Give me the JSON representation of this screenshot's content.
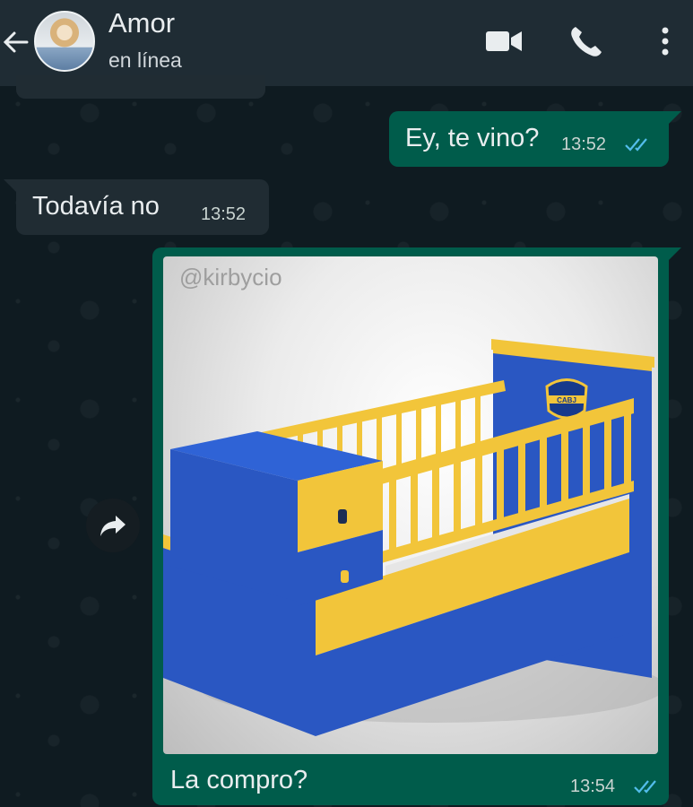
{
  "header": {
    "contact_name": "Amor",
    "status": "en línea",
    "back_icon": "back-arrow-icon",
    "icons": [
      "video-call-icon",
      "voice-call-icon",
      "more-options-icon"
    ]
  },
  "messages": [
    {
      "direction": "outgoing",
      "text": "Ey, te vino?",
      "time": "13:52",
      "status": "read"
    },
    {
      "direction": "incoming",
      "text": "Todavía no",
      "time": "13:52"
    },
    {
      "direction": "outgoing",
      "type": "image",
      "image_description_label": "crib",
      "watermark": "@kirbycio",
      "caption": "La compro?",
      "time": "13:54",
      "status": "read"
    }
  ],
  "crest_text": "CABJ",
  "colors": {
    "header_bg": "#1f2c34",
    "chat_bg": "#0b141a",
    "outgoing_bubble": "#005c4b",
    "incoming_bubble": "#202c33",
    "read_ticks": "#53bdeb",
    "crib_blue": "#2a57c2",
    "crib_yellow": "#f2c53a"
  }
}
